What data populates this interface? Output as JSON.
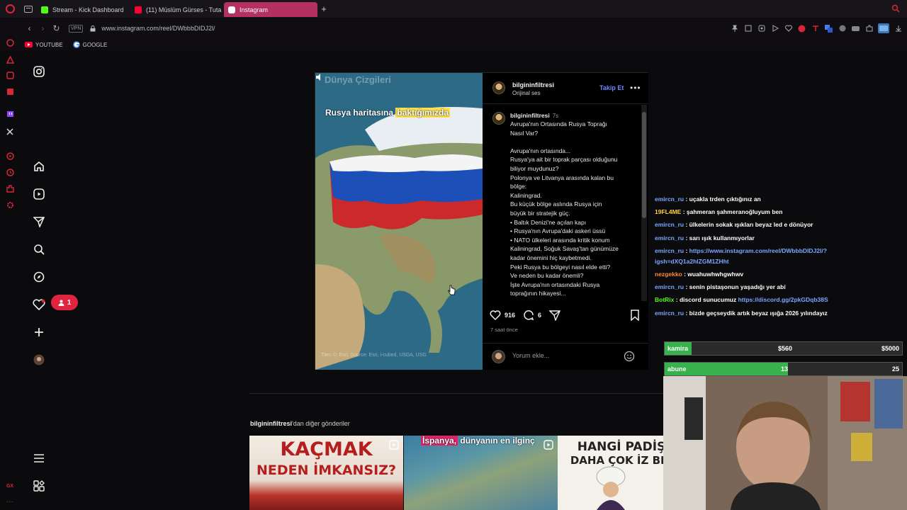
{
  "browser": {
    "tabs": [
      {
        "label": "Stream - Kick Dashboard",
        "color": "#53fc18"
      },
      {
        "label": "(11) Müslüm Gürses - Tuta",
        "color": "#ff0033"
      },
      {
        "label": "Instagram",
        "color": "#e1306c"
      }
    ],
    "vpn_label": "VPN",
    "url": "www.instagram.com/reel/DWbbbDIDJ2l/",
    "bookmarks": [
      {
        "label": "YOUTUBE"
      },
      {
        "label": "GOOGLE"
      }
    ]
  },
  "ig_nav": {
    "notification_count": "1"
  },
  "reel": {
    "video": {
      "watermark": "Dünya Çizgileri",
      "caption_plain": "Rusya haritasına ",
      "caption_highlight": "baktığımızda",
      "attribution": "Tiles ©: Esri; Source: Esri, i-cubed, USDA, USG"
    },
    "author": "bilgininfiltresi",
    "audio": "Orijinal ses",
    "follow_label": "Takip Et",
    "caption_author": "bilgininfiltresi",
    "caption_time": "7s",
    "caption_lines": [
      "Avrupa'nın Ortasında Rusya Toprağı",
      "Nasıl Var?",
      "",
      "Avrupa'nın ortasında...",
      "Rusya'ya ait bir toprak parçası olduğunu",
      "biliyor muydunuz?",
      "Polonya ve Litvanya arasında kalan bu",
      "bölge:",
      "Kaliningrad.",
      "Bu küçük bölge aslında Rusya için",
      "büyük bir stratejik güç.",
      "• Baltık Denizi'ne açılan kapı",
      "• Rusya'nın Avrupa'daki askeri üssü",
      "• NATO ülkeleri arasında kritik konum",
      "Kaliningrad, Soğuk Savaş'tan günümüze",
      "kadar önemini hiç kaybetmedi.",
      "Peki Rusya bu bölgeyi nasıl elde etti?",
      "Ve neden bu kadar önemli?",
      "İşte Avrupa'nın ortasındaki Rusya",
      "toprağının hikayesi..."
    ],
    "likes": "916",
    "comments": "6",
    "posted": "7 saat önce",
    "comment_placeholder": "Yorum ekle..."
  },
  "more_posts": {
    "author": "bilgininfiltresi",
    "suffix": "'dan diğer gönderiler",
    "thumbs": [
      {
        "line1": "KAÇMAK",
        "line2": "NEDEN İMKANSIZ?"
      },
      {
        "highlight": "İspanya,",
        "rest": " dünyanın en ilginç"
      },
      {
        "line1": "HANGİ PADİŞ",
        "line2": "DAHA ÇOK İZ BIR"
      }
    ]
  },
  "stream_chat": [
    {
      "user": "emircn_ru",
      "color": "#7aa7ff",
      "text": " : uçakla trden çıktığınız an"
    },
    {
      "user": "19FL4ME",
      "color": "#ffd23f",
      "text": " : şahmeran şahmeranoğluyum ben"
    },
    {
      "user": "emircn_ru",
      "color": "#7aa7ff",
      "text": " : ülkelerin sokak ışıkları beyaz led e dönüyor"
    },
    {
      "user": "emircn_ru",
      "color": "#7aa7ff",
      "text": " : sarı ışık kullanmıyorlar"
    },
    {
      "user": "emircn_ru",
      "color": "#7aa7ff",
      "text": " : ",
      "link": "https://www.instagram.com/reel/DWbbbDIDJ2l/?",
      "link2": "igsh=dXQ1a2hlZGM1ZHht"
    },
    {
      "user": "nezgekko",
      "color": "#ff8a3d",
      "text": " : wuahuwhwhgwhwv"
    },
    {
      "user": "emircn_ru",
      "color": "#7aa7ff",
      "text": " : senin pistaşonun yaşadığı yer abi"
    },
    {
      "user": "BotRix",
      "color": "#53fc18",
      "text": " : discord sunucumuz ",
      "link": "https://discord.gg/2pkGDqb38S"
    },
    {
      "user": "emircn_ru",
      "color": "#7aa7ff",
      "text": " : bizde geçseydik artık beyaz ışığa 2026 yılındayız"
    }
  ],
  "goals": [
    {
      "label": "kamira",
      "current": "$560",
      "target": "$5000",
      "progress": 0.112
    },
    {
      "label": "abune",
      "current": "13",
      "target": "25",
      "progress": 0.52
    }
  ]
}
